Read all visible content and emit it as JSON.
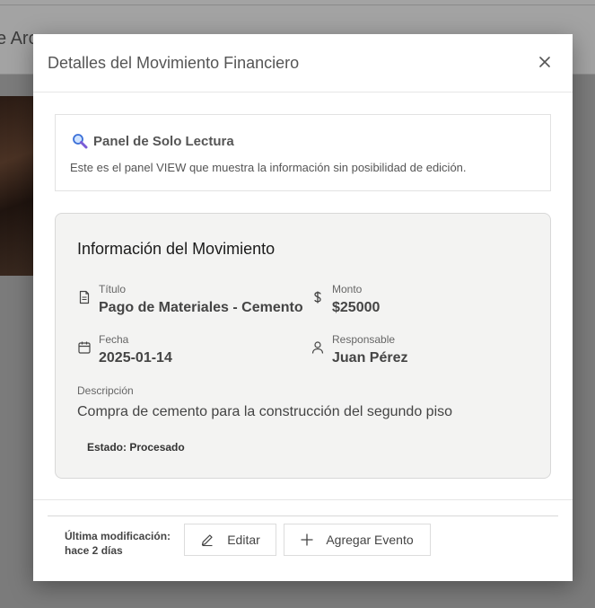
{
  "background": {
    "title_fragment": "e Arc"
  },
  "modal": {
    "title": "Detalles del Movimiento Financiero",
    "close_label": "×"
  },
  "info_panel": {
    "icon": "magnifier-icon",
    "heading": "Panel de Solo Lectura",
    "text": "Este es el panel VIEW que muestra la información sin posibilidad de edición."
  },
  "card": {
    "title": "Información del Movimiento",
    "fields": {
      "titulo": {
        "label": "Título",
        "value": "Pago de Materiales - Cemento",
        "icon": "document-icon"
      },
      "monto": {
        "label": "Monto",
        "value": "$25000",
        "icon": "dollar-icon"
      },
      "fecha": {
        "label": "Fecha",
        "value": "2025-01-14",
        "icon": "calendar-icon"
      },
      "responsable": {
        "label": "Responsable",
        "value": "Juan Pérez",
        "icon": "user-icon"
      }
    },
    "description_label": "Descripción",
    "description": "Compra de cemento para la construcción del segundo piso",
    "status": "Estado: Procesado"
  },
  "footer": {
    "last_modified_label": "Última modificación:",
    "last_modified_value": "hace 2 días",
    "edit_label": "Editar",
    "add_event_label": "Agregar Evento"
  },
  "colors": {
    "overlay": "#7b7b7b",
    "card_bg": "#f3f3f2",
    "magnifier_accent": "#7b5cd6"
  }
}
